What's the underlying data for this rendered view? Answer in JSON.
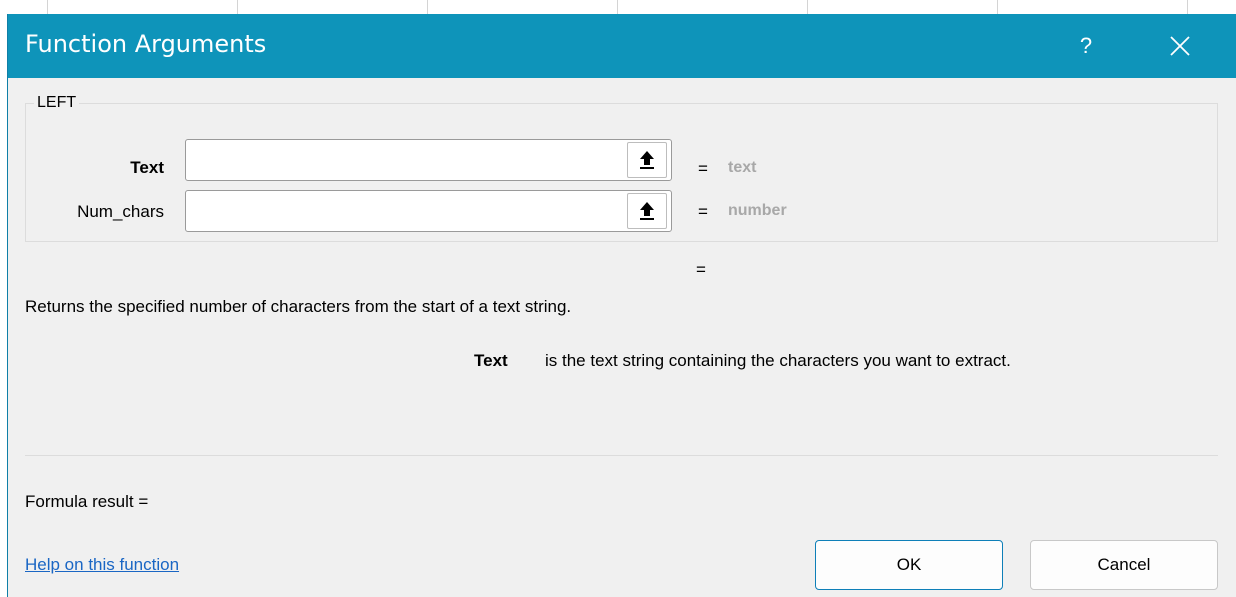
{
  "dialog": {
    "title": "Function Arguments",
    "help_symbol": "?",
    "function_name": "LEFT"
  },
  "arguments": [
    {
      "label": "Text",
      "value": "",
      "equals": "=",
      "hint": "text"
    },
    {
      "label": "Num_chars",
      "value": "",
      "equals": "=",
      "hint": "number"
    }
  ],
  "result_equals": "=",
  "description": "Returns the specified number of characters from the start of a text string.",
  "arg_help": {
    "name": "Text",
    "text": "is the text string containing the characters you want to extract."
  },
  "formula_result": "Formula result =",
  "help_link": "Help on this function",
  "buttons": {
    "ok": "OK",
    "cancel": "Cancel"
  },
  "colors": {
    "titlebar": "#0e94ba",
    "dialog_bg": "#f0f0f0",
    "hint": "#a8a8a8",
    "link": "#1a66c4"
  },
  "icons": {
    "help": "help-icon",
    "close": "close-icon",
    "collapse": "collapse-dialog-icon"
  }
}
